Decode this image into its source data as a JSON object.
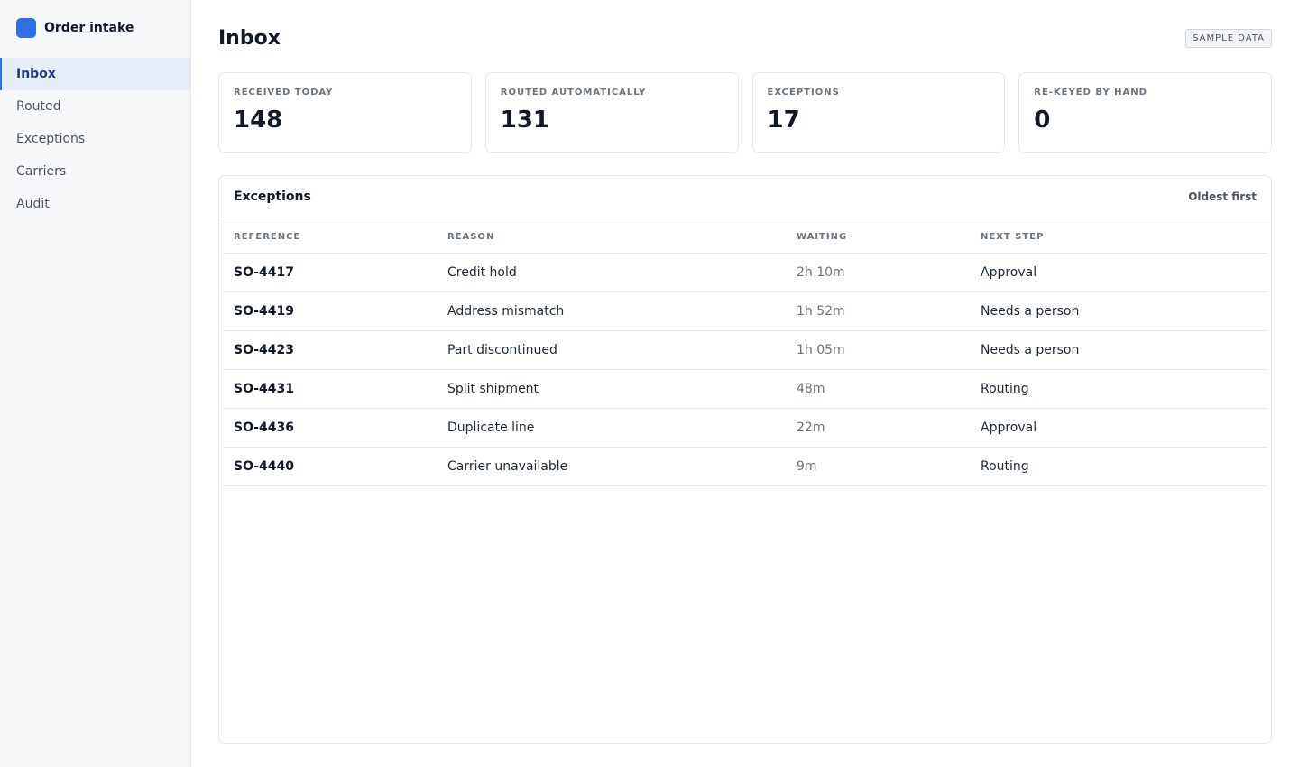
{
  "app": {
    "name": "Order intake",
    "brand_color": "#2f6fe8"
  },
  "sidebar": {
    "items": [
      {
        "label": "Inbox",
        "active": true
      },
      {
        "label": "Routed",
        "active": false
      },
      {
        "label": "Exceptions",
        "active": false
      },
      {
        "label": "Carriers",
        "active": false
      },
      {
        "label": "Audit",
        "active": false
      }
    ]
  },
  "header": {
    "title": "Inbox",
    "badge": "SAMPLE DATA"
  },
  "stats": [
    {
      "label": "RECEIVED TODAY",
      "value": "148"
    },
    {
      "label": "ROUTED AUTOMATICALLY",
      "value": "131"
    },
    {
      "label": "EXCEPTIONS",
      "value": "17"
    },
    {
      "label": "RE-KEYED BY HAND",
      "value": "0"
    }
  ],
  "exceptions": {
    "title": "Exceptions",
    "sort_label": "Oldest first",
    "columns": [
      "REFERENCE",
      "REASON",
      "WAITING",
      "NEXT STEP"
    ],
    "rows": [
      {
        "reference": "SO-4417",
        "reason": "Credit hold",
        "waiting": "2h 10m",
        "next_step": "Approval"
      },
      {
        "reference": "SO-4419",
        "reason": "Address mismatch",
        "waiting": "1h 52m",
        "next_step": "Needs a person"
      },
      {
        "reference": "SO-4423",
        "reason": "Part discontinued",
        "waiting": "1h 05m",
        "next_step": "Needs a person"
      },
      {
        "reference": "SO-4431",
        "reason": "Split shipment",
        "waiting": "48m",
        "next_step": "Routing"
      },
      {
        "reference": "SO-4436",
        "reason": "Duplicate line",
        "waiting": "22m",
        "next_step": "Approval"
      },
      {
        "reference": "SO-4440",
        "reason": "Carrier unavailable",
        "waiting": "9m",
        "next_step": "Routing"
      }
    ]
  }
}
